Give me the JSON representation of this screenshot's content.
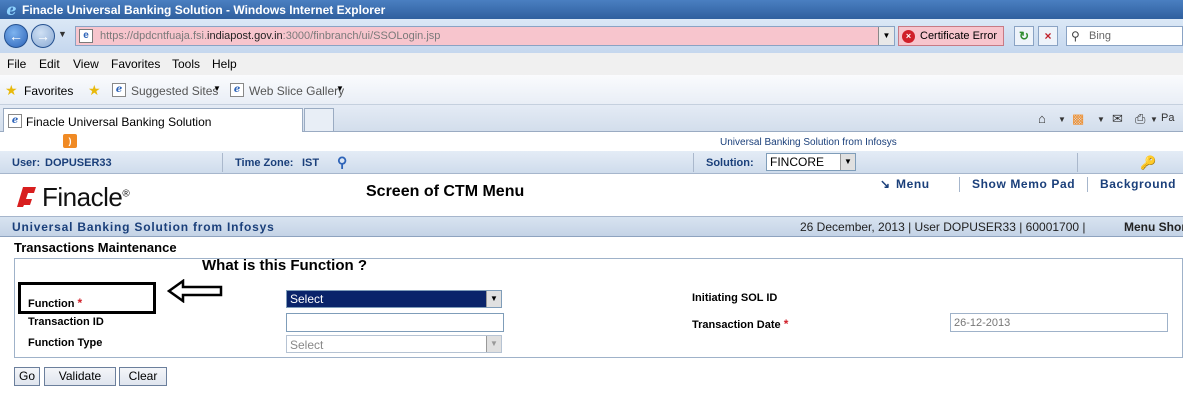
{
  "window": {
    "title": "Finacle Universal Banking Solution - Windows Internet Explorer"
  },
  "address_bar": {
    "url_prefix": "https://dpdcntfuaja.fsi.",
    "url_domain": "indiapost.gov.in",
    "url_suffix": ":3000/finbranch/ui/SSOLogin.jsp",
    "cert_error": "Certificate Error",
    "search_placeholder": "Bing"
  },
  "menu": {
    "file": "File",
    "edit": "Edit",
    "view": "View",
    "favorites": "Favorites",
    "tools": "Tools",
    "help": "Help"
  },
  "favorites_bar": {
    "favorites": "Favorites",
    "suggested_sites": "Suggested Sites",
    "web_slice_gallery": "Web Slice Gallery"
  },
  "tabs": {
    "active_label": "Finacle Universal Banking Solution",
    "page_cmd": "Pa"
  },
  "app": {
    "top_banner": "Universal Banking Solution from Infosys",
    "user_label": "User:",
    "user_value": "DOPUSER33",
    "timezone_label": "Time Zone:",
    "timezone_value": "IST",
    "solution_label": "Solution:",
    "solution_value": "FINCORE",
    "logo_text": "Finacle",
    "logo_mark": "®",
    "caption": "Screen of CTM Menu",
    "top_links": {
      "menu": "Menu",
      "memo_pad": "Show Memo Pad",
      "background": "Background"
    },
    "info_left": "Universal Banking Solution from Infosys",
    "info_right": "26 December, 2013 | User DOPUSER33 | 60001700 |",
    "menu_shortcut": "Menu Shor",
    "page_title": "Transactions Maintenance",
    "question": "What is this Function ?",
    "form": {
      "function_label": "Function",
      "function_value": "Select",
      "transaction_id_label": "Transaction ID",
      "transaction_id_value": "",
      "function_type_label": "Function Type",
      "function_type_value": "Select",
      "initiating_sol_label": "Initiating SOL ID",
      "transaction_date_label": "Transaction Date",
      "transaction_date_value": "26-12-2013",
      "required_mark": "*"
    },
    "buttons": {
      "go": "Go",
      "validate": "Validate",
      "clear": "Clear"
    }
  }
}
